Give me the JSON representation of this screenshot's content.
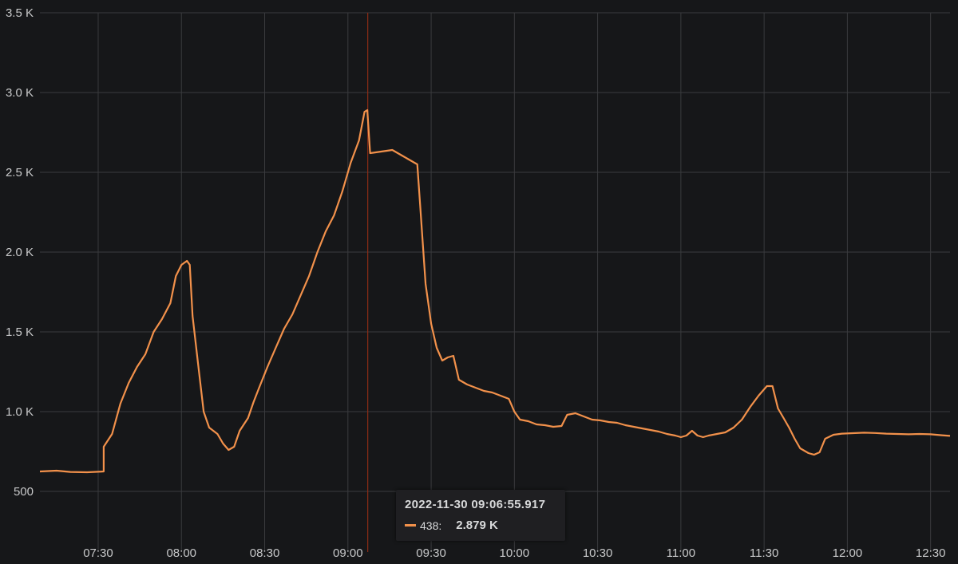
{
  "colors": {
    "background": "#161719",
    "series": "#f2914b",
    "grid": "#3a3b3e",
    "cursor": "#8a2b17",
    "tick_text": "#c8c9ca"
  },
  "chart_data": {
    "type": "line",
    "ylim": [
      500,
      3500
    ],
    "xlim": [
      "07:09",
      "12:37"
    ],
    "grid": true,
    "yticks": [
      {
        "v": 500,
        "label": "500"
      },
      {
        "v": 1000,
        "label": "1.0 K"
      },
      {
        "v": 1500,
        "label": "1.5 K"
      },
      {
        "v": 2000,
        "label": "2.0 K"
      },
      {
        "v": 2500,
        "label": "2.5 K"
      },
      {
        "v": 3000,
        "label": "3.0 K"
      },
      {
        "v": 3500,
        "label": "3.5 K"
      }
    ],
    "xticks": [
      "07:30",
      "08:00",
      "08:30",
      "09:00",
      "09:30",
      "10:00",
      "10:30",
      "11:00",
      "11:30",
      "12:00",
      "12:30"
    ],
    "series": [
      {
        "name": "438",
        "points": [
          [
            "07:09",
            625
          ],
          [
            "07:15",
            630
          ],
          [
            "07:20",
            622
          ],
          [
            "07:26",
            620
          ],
          [
            "07:32",
            625
          ],
          [
            "07:32",
            780
          ],
          [
            "07:35",
            860
          ],
          [
            "07:38",
            1050
          ],
          [
            "07:41",
            1180
          ],
          [
            "07:44",
            1280
          ],
          [
            "07:47",
            1360
          ],
          [
            "07:50",
            1500
          ],
          [
            "07:53",
            1580
          ],
          [
            "07:56",
            1680
          ],
          [
            "07:58",
            1850
          ],
          [
            "08:00",
            1920
          ],
          [
            "08:02",
            1945
          ],
          [
            "08:03",
            1920
          ],
          [
            "08:04",
            1600
          ],
          [
            "08:06",
            1300
          ],
          [
            "08:08",
            1000
          ],
          [
            "08:10",
            900
          ],
          [
            "08:13",
            860
          ],
          [
            "08:15",
            800
          ],
          [
            "08:17",
            760
          ],
          [
            "08:19",
            780
          ],
          [
            "08:21",
            880
          ],
          [
            "08:24",
            960
          ],
          [
            "08:26",
            1060
          ],
          [
            "08:28",
            1150
          ],
          [
            "08:31",
            1280
          ],
          [
            "08:34",
            1400
          ],
          [
            "08:37",
            1520
          ],
          [
            "08:40",
            1610
          ],
          [
            "08:43",
            1730
          ],
          [
            "08:46",
            1850
          ],
          [
            "08:49",
            2000
          ],
          [
            "08:52",
            2130
          ],
          [
            "08:55",
            2230
          ],
          [
            "08:58",
            2380
          ],
          [
            "09:01",
            2560
          ],
          [
            "09:04",
            2700
          ],
          [
            "09:06",
            2879
          ],
          [
            "09:07",
            2890
          ],
          [
            "09:08",
            2620
          ],
          [
            "09:12",
            2630
          ],
          [
            "09:16",
            2640
          ],
          [
            "09:20",
            2600
          ],
          [
            "09:24",
            2560
          ],
          [
            "09:25",
            2550
          ],
          [
            "09:26",
            2300
          ],
          [
            "09:28",
            1800
          ],
          [
            "09:30",
            1550
          ],
          [
            "09:32",
            1400
          ],
          [
            "09:34",
            1320
          ],
          [
            "09:36",
            1340
          ],
          [
            "09:38",
            1350
          ],
          [
            "09:40",
            1200
          ],
          [
            "09:43",
            1170
          ],
          [
            "09:46",
            1150
          ],
          [
            "09:49",
            1130
          ],
          [
            "09:52",
            1120
          ],
          [
            "09:55",
            1100
          ],
          [
            "09:58",
            1080
          ],
          [
            "10:00",
            1000
          ],
          [
            "10:02",
            950
          ],
          [
            "10:05",
            940
          ],
          [
            "10:08",
            920
          ],
          [
            "10:11",
            915
          ],
          [
            "10:14",
            905
          ],
          [
            "10:17",
            910
          ],
          [
            "10:19",
            980
          ],
          [
            "10:22",
            990
          ],
          [
            "10:25",
            970
          ],
          [
            "10:28",
            950
          ],
          [
            "10:31",
            945
          ],
          [
            "10:34",
            935
          ],
          [
            "10:37",
            930
          ],
          [
            "10:40",
            915
          ],
          [
            "10:43",
            905
          ],
          [
            "10:46",
            895
          ],
          [
            "10:49",
            885
          ],
          [
            "10:52",
            875
          ],
          [
            "10:55",
            860
          ],
          [
            "10:58",
            850
          ],
          [
            "11:00",
            840
          ],
          [
            "11:02",
            850
          ],
          [
            "11:04",
            880
          ],
          [
            "11:06",
            850
          ],
          [
            "11:08",
            840
          ],
          [
            "11:10",
            850
          ],
          [
            "11:13",
            860
          ],
          [
            "11:16",
            870
          ],
          [
            "11:19",
            900
          ],
          [
            "11:22",
            950
          ],
          [
            "11:25",
            1030
          ],
          [
            "11:28",
            1100
          ],
          [
            "11:31",
            1160
          ],
          [
            "11:33",
            1160
          ],
          [
            "11:35",
            1020
          ],
          [
            "11:37",
            960
          ],
          [
            "11:39",
            900
          ],
          [
            "11:41",
            830
          ],
          [
            "11:43",
            770
          ],
          [
            "11:46",
            740
          ],
          [
            "11:48",
            730
          ],
          [
            "11:50",
            745
          ],
          [
            "11:52",
            830
          ],
          [
            "11:55",
            855
          ],
          [
            "11:58",
            862
          ],
          [
            "12:02",
            865
          ],
          [
            "12:06",
            868
          ],
          [
            "12:10",
            866
          ],
          [
            "12:14",
            862
          ],
          [
            "12:18",
            860
          ],
          [
            "12:22",
            858
          ],
          [
            "12:26",
            860
          ],
          [
            "12:30",
            858
          ],
          [
            "12:34",
            852
          ],
          [
            "12:37",
            848
          ]
        ]
      }
    ],
    "cursor_time": "09:06"
  },
  "tooltip": {
    "timestamp": "2022-11-30 09:06:55.917",
    "series_label": "438:",
    "value": "2.879 K"
  }
}
